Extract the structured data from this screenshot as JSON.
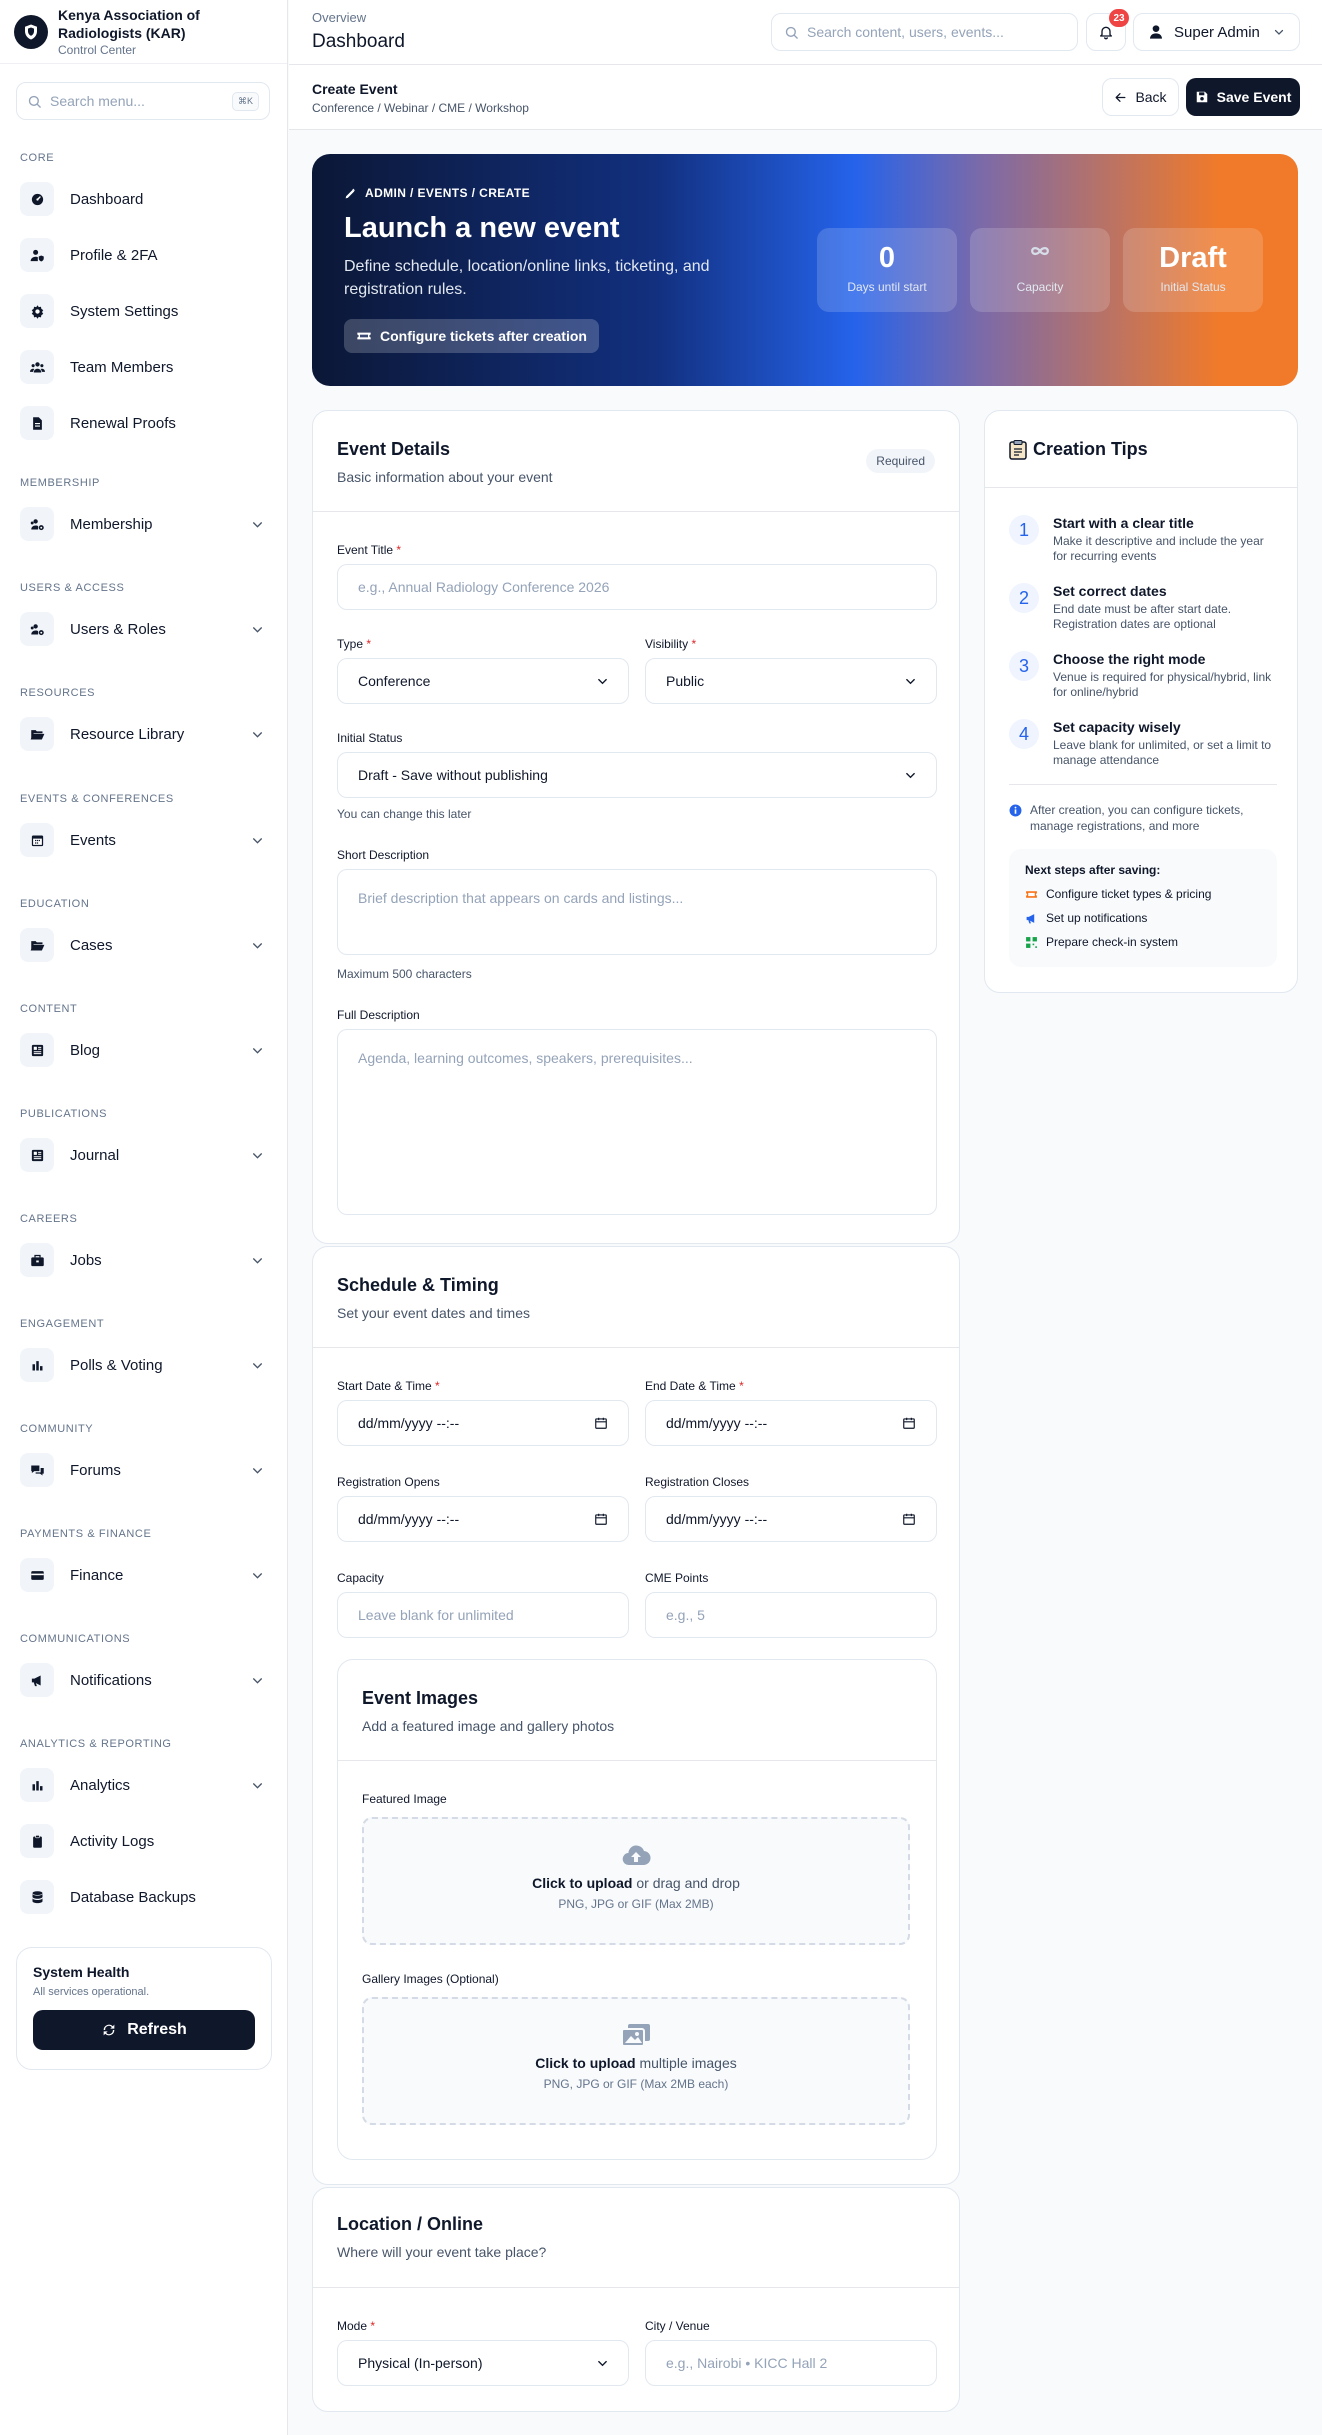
{
  "brand": {
    "name": "Kenya Association of Radiologists (KAR)",
    "subtitle": "Control Center"
  },
  "sidebar_search": {
    "placeholder": "Search menu...",
    "shortcut": "⌘K"
  },
  "sidebar": [
    {
      "section": "CORE",
      "items": [
        {
          "label": "Dashboard",
          "icon": "gauge-icon"
        },
        {
          "label": "Profile & 2FA",
          "icon": "user-shield-icon"
        },
        {
          "label": "System Settings",
          "icon": "gear-icon"
        },
        {
          "label": "Team Members",
          "icon": "users-icon"
        },
        {
          "label": "Renewal Proofs",
          "icon": "file-icon"
        }
      ]
    },
    {
      "section": "MEMBERSHIP",
      "items": [
        {
          "label": "Membership",
          "icon": "users-cog-icon",
          "expandable": true
        }
      ]
    },
    {
      "section": "USERS & ACCESS",
      "items": [
        {
          "label": "Users & Roles",
          "icon": "users-cog-icon",
          "expandable": true
        }
      ]
    },
    {
      "section": "RESOURCES",
      "items": [
        {
          "label": "Resource Library",
          "icon": "folder-open-icon",
          "expandable": true
        }
      ]
    },
    {
      "section": "EVENTS & CONFERENCES",
      "items": [
        {
          "label": "Events",
          "icon": "calendar-icon",
          "expandable": true
        }
      ]
    },
    {
      "section": "EDUCATION",
      "items": [
        {
          "label": "Cases",
          "icon": "folder-open-icon",
          "expandable": true
        }
      ]
    },
    {
      "section": "CONTENT",
      "items": [
        {
          "label": "Blog",
          "icon": "newspaper-icon",
          "expandable": true
        }
      ]
    },
    {
      "section": "PUBLICATIONS",
      "items": [
        {
          "label": "Journal",
          "icon": "newspaper-icon",
          "expandable": true
        }
      ]
    },
    {
      "section": "CAREERS",
      "items": [
        {
          "label": "Jobs",
          "icon": "briefcase-icon",
          "expandable": true
        }
      ]
    },
    {
      "section": "ENGAGEMENT",
      "items": [
        {
          "label": "Polls & Voting",
          "icon": "bar-chart-icon",
          "expandable": true
        }
      ]
    },
    {
      "section": "COMMUNITY",
      "items": [
        {
          "label": "Forums",
          "icon": "comments-icon",
          "expandable": true
        }
      ]
    },
    {
      "section": "PAYMENTS & FINANCE",
      "items": [
        {
          "label": "Finance",
          "icon": "credit-card-icon",
          "expandable": true
        }
      ]
    },
    {
      "section": "COMMUNICATIONS",
      "items": [
        {
          "label": "Notifications",
          "icon": "megaphone-icon",
          "expandable": true
        }
      ]
    },
    {
      "section": "ANALYTICS & REPORTING",
      "items": [
        {
          "label": "Analytics",
          "icon": "bar-chart-icon",
          "expandable": true
        },
        {
          "label": "Activity Logs",
          "icon": "clipboard-icon"
        },
        {
          "label": "Database Backups",
          "icon": "database-icon"
        }
      ]
    }
  ],
  "health": {
    "title": "System Health",
    "status": "All services operational.",
    "button": "Refresh"
  },
  "topbar": {
    "overview": "Overview",
    "title": "Dashboard",
    "search_placeholder": "Search content, users, events...",
    "notifications": "23",
    "user": "Super Admin"
  },
  "page": {
    "title": "Create Event",
    "breadcrumb": "Conference / Webinar / CME / Workshop",
    "back": "Back",
    "save": "Save Event"
  },
  "hero": {
    "crumb": "ADMIN / EVENTS / CREATE",
    "title": "Launch a new event",
    "description": "Define schedule, location/online links, ticketing, and registration rules.",
    "button": "Configure tickets after creation",
    "stats": [
      {
        "value": "0",
        "label": "Days until start"
      },
      {
        "value": "",
        "icon": "infinity-icon",
        "label": "Capacity"
      },
      {
        "value": "Draft",
        "label": "Initial Status"
      }
    ]
  },
  "details": {
    "title": "Event Details",
    "subtitle": "Basic information about your event",
    "badge": "Required",
    "event_title_label": "Event Title",
    "event_title_placeholder": "e.g., Annual Radiology Conference 2026",
    "type_label": "Type",
    "type_value": "Conference",
    "visibility_label": "Visibility",
    "visibility_value": "Public",
    "status_label": "Initial Status",
    "status_value": "Draft - Save without publishing",
    "status_hint": "You can change this later",
    "short_label": "Short Description",
    "short_placeholder": "Brief description that appears on cards and listings...",
    "short_hint": "Maximum 500 characters",
    "full_label": "Full Description",
    "full_placeholder": "Agenda, learning outcomes, speakers, prerequisites..."
  },
  "schedule": {
    "title": "Schedule & Timing",
    "subtitle": "Set your event dates and times",
    "start_label": "Start Date & Time",
    "end_label": "End Date & Time",
    "reg_open_label": "Registration Opens",
    "reg_close_label": "Registration Closes",
    "date_placeholder": "dd/mm/yyyy --:--",
    "capacity_label": "Capacity",
    "capacity_placeholder": "Leave blank for unlimited",
    "cme_label": "CME Points",
    "cme_placeholder": "e.g., 5"
  },
  "images": {
    "title": "Event Images",
    "subtitle": "Add a featured image and gallery photos",
    "featured_label": "Featured Image",
    "featured_action": "Click to upload",
    "featured_rest": " or drag and drop",
    "featured_note": "PNG, JPG or GIF (Max 2MB)",
    "gallery_label": "Gallery Images (Optional)",
    "gallery_action": "Click to upload",
    "gallery_rest": " multiple images",
    "gallery_note": "PNG, JPG or GIF (Max 2MB each)"
  },
  "location": {
    "title": "Location / Online",
    "subtitle": "Where will your event take place?",
    "mode_label": "Mode",
    "mode_value": "Physical (In-person)",
    "venue_label": "City / Venue",
    "venue_placeholder": "e.g., Nairobi • KICC Hall 2"
  },
  "tips": {
    "title": "Creation Tips",
    "items": [
      {
        "num": "1",
        "title": "Start with a clear title",
        "desc": "Make it descriptive and include the year for recurring events"
      },
      {
        "num": "2",
        "title": "Set correct dates",
        "desc": "End date must be after start date. Registration dates are optional"
      },
      {
        "num": "3",
        "title": "Choose the right mode",
        "desc": "Venue is required for physical/hybrid, link for online/hybrid"
      },
      {
        "num": "4",
        "title": "Set capacity wisely",
        "desc": "Leave blank for unlimited, or set a limit to manage attendance"
      }
    ],
    "note": "After creation, you can configure tickets, manage registrations, and more",
    "next_title": "Next steps after saving:",
    "next": [
      {
        "label": "Configure ticket types & pricing",
        "icon": "ticket-icon",
        "color": "#f97316"
      },
      {
        "label": "Set up notifications",
        "icon": "megaphone-icon",
        "color": "#2563eb"
      },
      {
        "label": "Prepare check-in system",
        "icon": "qrcode-icon",
        "color": "#16a34a"
      }
    ]
  },
  "colors": {
    "primary": "#0f172a",
    "accent": "#2563eb",
    "danger": "#ef4444",
    "hero_end": "#f07a2a"
  }
}
